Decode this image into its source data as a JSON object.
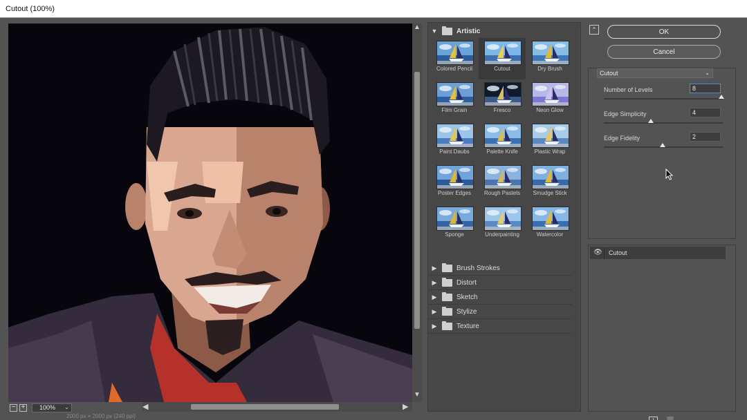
{
  "window": {
    "title": "Cutout (100%)"
  },
  "preview": {
    "zoom_value": "100%",
    "zoom_out_icon": "minus-icon",
    "zoom_in_icon": "plus-icon",
    "status_text": "2000 px × 2000 px (240 ppi)"
  },
  "gallery": {
    "open_category": "Artistic",
    "thumbnails": [
      "Colored Pencil",
      "Cutout",
      "Dry Brush",
      "Film Grain",
      "Fresco",
      "Neon Glow",
      "Paint Daubs",
      "Palette Knife",
      "Plastic Wrap",
      "Poster Edges",
      "Rough Pastels",
      "Smudge Stick",
      "Sponge",
      "Underpainting",
      "Watercolor"
    ],
    "selected_thumbnail": "Cutout",
    "categories": [
      "Brush Strokes",
      "Distort",
      "Sketch",
      "Stylize",
      "Texture"
    ]
  },
  "buttons": {
    "ok": "OK",
    "cancel": "Cancel"
  },
  "settings": {
    "filter": "Cutout",
    "params": [
      {
        "label": "Number of Levels",
        "value": "8",
        "min": 2,
        "max": 8
      },
      {
        "label": "Edge Simplicity",
        "value": "4",
        "min": 0,
        "max": 10
      },
      {
        "label": "Edge Fidelity",
        "value": "2",
        "min": 1,
        "max": 3
      }
    ]
  },
  "layers": {
    "items": [
      "Cutout"
    ]
  },
  "colors": {
    "accent": "#4b8fdc",
    "panel": "#535353",
    "canvas": "#07060c"
  }
}
